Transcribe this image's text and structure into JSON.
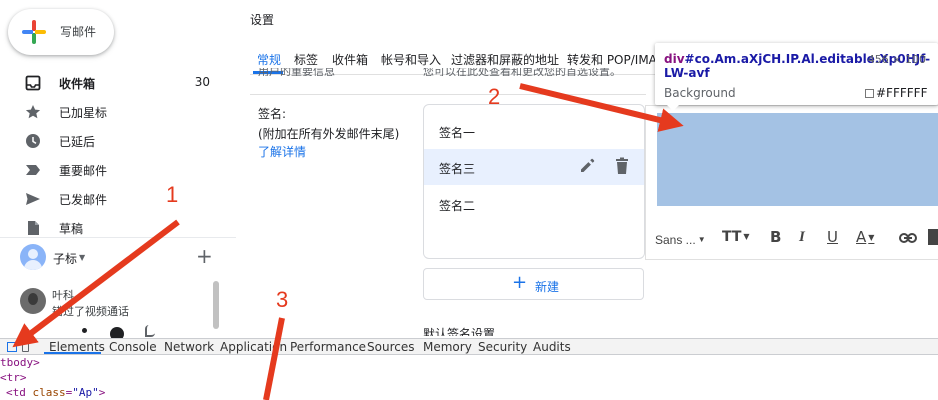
{
  "compose": {
    "label": "写邮件"
  },
  "nav": {
    "items": [
      {
        "label": "收件箱",
        "icon": "inbox-icon",
        "count": "30",
        "bold": true
      },
      {
        "label": "已加星标",
        "icon": "star-icon"
      },
      {
        "label": "已延后",
        "icon": "clock-icon"
      },
      {
        "label": "重要邮件",
        "icon": "label-icon"
      },
      {
        "label": "已发邮件",
        "icon": "send-icon"
      },
      {
        "label": "草稿",
        "icon": "draft-icon"
      }
    ]
  },
  "account": {
    "name": "子标",
    "add_symbol": "+"
  },
  "hangouts": {
    "contact": "叶科",
    "message": "错过了视频通话"
  },
  "settings": {
    "title": "设置",
    "tabs": [
      "常规",
      "标签",
      "收件箱",
      "帐号和导入",
      "过滤器和屏蔽的地址",
      "转发和 POP/IMAP"
    ],
    "active_tab": "常规",
    "clipped_text_left": "用户的重要信息",
    "clipped_text_right": "您可以在此处查看和更改您的首选设置。",
    "signature": {
      "label": "签名:",
      "note": "(附加在所有外发邮件末尾)",
      "learn_more": "了解详情",
      "items": [
        "签名一",
        "签名三",
        "签名二"
      ],
      "selected": "签名三",
      "new_plus": "+",
      "new_label": "新建"
    },
    "default_label": "默认签名设置"
  },
  "toolbar": {
    "font": "Sans ...",
    "size_icon": "TT",
    "bold": "B",
    "italic": "I",
    "underline": "U",
    "text_color": "A"
  },
  "inspector": {
    "tag": "div",
    "selector": "#co.Am.aXjCH.IP.Al.editable.Xp0HJf-LW-avf",
    "size": "456 × 100",
    "bg_label": "Background",
    "bg_value": "#FFFFFF",
    "highlight_color": "#a4c2e4"
  },
  "devtools": {
    "tabs": [
      "Elements",
      "Console",
      "Network",
      "Application",
      "Performance",
      "Sources",
      "Memory",
      "Security",
      "Audits"
    ],
    "active_tab": "Elements",
    "code": {
      "line1_tag": "tbody>",
      "line2_tag": "<tr>",
      "line3_open": "<td ",
      "line3_attr": "class",
      "line3_eq": "=",
      "line3_val": "\"Ap\"",
      "line3_close": ">"
    }
  },
  "annotations": {
    "labels": [
      "1",
      "2",
      "3"
    ],
    "color": "#e53a1e"
  },
  "colors": {
    "accent": "#1a73e8",
    "selected_row": "#e8f0fe"
  }
}
